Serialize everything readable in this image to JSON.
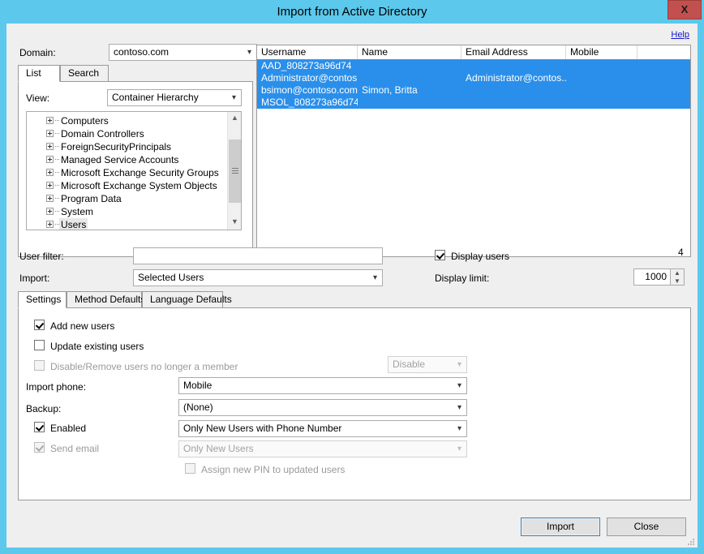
{
  "window": {
    "title": "Import from Active Directory",
    "close_label": "X",
    "accent_color": "#5BC8EC",
    "close_color": "#C1504E"
  },
  "help": {
    "label": "Help"
  },
  "domain": {
    "label": "Domain:",
    "value": "contoso.com"
  },
  "source_tabs": [
    {
      "label": "List",
      "active": true
    },
    {
      "label": "Search",
      "active": false
    }
  ],
  "view": {
    "label": "View:",
    "value": "Container Hierarchy"
  },
  "tree": {
    "items": [
      {
        "label": "Computers",
        "selected": false
      },
      {
        "label": "Domain Controllers",
        "selected": false
      },
      {
        "label": "ForeignSecurityPrincipals",
        "selected": false
      },
      {
        "label": "Managed Service Accounts",
        "selected": false
      },
      {
        "label": "Microsoft Exchange Security Groups",
        "selected": false
      },
      {
        "label": "Microsoft Exchange System Objects",
        "selected": false
      },
      {
        "label": "Program Data",
        "selected": false
      },
      {
        "label": "System",
        "selected": false
      },
      {
        "label": "Users",
        "selected": true
      }
    ]
  },
  "userlist": {
    "columns": [
      "Username",
      "Name",
      "Email Address",
      "Mobile"
    ],
    "rows": [
      {
        "username": "AAD_808273a96d74",
        "name": "",
        "email": "",
        "mobile": "",
        "selected": true
      },
      {
        "username": "Administrator@contos...",
        "name": "",
        "email": "Administrator@contos...",
        "mobile": "",
        "selected": true
      },
      {
        "username": "bsimon@contoso.com",
        "name": "Simon, Britta",
        "email": "",
        "mobile": "",
        "selected": true
      },
      {
        "username": "MSOL_808273a96d74",
        "name": "",
        "email": "",
        "mobile": "",
        "selected": true
      }
    ],
    "count": "4"
  },
  "filter": {
    "user_filter_label": "User filter:",
    "user_filter_value": "",
    "import_label": "Import:",
    "import_value": "Selected Users",
    "display_users_label": "Display users",
    "display_users_checked": true,
    "display_limit_label": "Display limit:",
    "display_limit_value": "1000"
  },
  "settings_tabs": [
    {
      "label": "Settings",
      "active": true
    },
    {
      "label": "Method Defaults",
      "active": false
    },
    {
      "label": "Language Defaults",
      "active": false
    }
  ],
  "settings": {
    "add_new_users": {
      "label": "Add new users",
      "checked": true,
      "disabled": false
    },
    "update_existing_users": {
      "label": "Update existing users",
      "checked": false,
      "disabled": false
    },
    "disable_remove": {
      "label": "Disable/Remove users no longer a member",
      "checked": false,
      "disabled": true
    },
    "disable_remove_action": {
      "value": "Disable",
      "disabled": true
    },
    "import_phone": {
      "label": "Import phone:",
      "value": "Mobile",
      "disabled": false
    },
    "backup": {
      "label": "Backup:",
      "value": "(None)",
      "disabled": false
    },
    "enabled": {
      "label": "Enabled",
      "checked": true,
      "disabled": false,
      "value": "Only New Users with Phone Number"
    },
    "send_email": {
      "label": "Send email",
      "checked": true,
      "disabled": true,
      "value": "Only New Users"
    },
    "assign_pin": {
      "label": "Assign new PIN to updated users",
      "checked": false,
      "disabled": true
    }
  },
  "footer": {
    "import_label": "Import",
    "close_label": "Close"
  }
}
